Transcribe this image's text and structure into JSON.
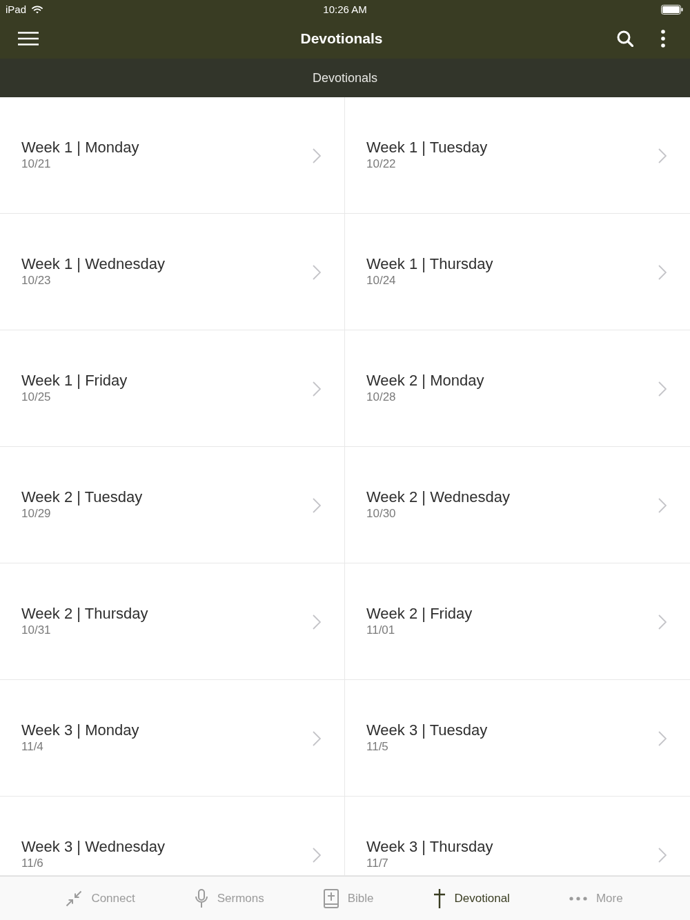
{
  "status_bar": {
    "device": "iPad",
    "time": "10:26 AM"
  },
  "nav_bar": {
    "title": "Devotionals"
  },
  "section_header": {
    "title": "Devotionals"
  },
  "devotionals": [
    {
      "title": "Week 1 | Monday",
      "date": "10/21"
    },
    {
      "title": "Week 1 | Tuesday",
      "date": "10/22"
    },
    {
      "title": "Week 1 | Wednesday",
      "date": "10/23"
    },
    {
      "title": "Week 1 | Thursday",
      "date": "10/24"
    },
    {
      "title": "Week 1 | Friday",
      "date": "10/25"
    },
    {
      "title": "Week 2 | Monday",
      "date": "10/28"
    },
    {
      "title": "Week 2 | Tuesday",
      "date": "10/29"
    },
    {
      "title": "Week 2 | Wednesday",
      "date": "10/30"
    },
    {
      "title": "Week 2 | Thursday",
      "date": "10/31"
    },
    {
      "title": "Week 2 | Friday",
      "date": "11/01"
    },
    {
      "title": "Week 3 | Monday",
      "date": "11/4"
    },
    {
      "title": "Week 3 | Tuesday",
      "date": "11/5"
    },
    {
      "title": "Week 3 | Wednesday",
      "date": "11/6"
    },
    {
      "title": "Week 3 | Thursday",
      "date": "11/7"
    }
  ],
  "tab_bar": [
    {
      "kind": "connect",
      "label": "Connect",
      "selected": false
    },
    {
      "kind": "sermons",
      "label": "Sermons",
      "selected": false
    },
    {
      "kind": "bible",
      "label": "Bible",
      "selected": false
    },
    {
      "kind": "devotional",
      "label": "Devotional",
      "selected": true
    },
    {
      "kind": "more",
      "label": "More",
      "selected": false
    }
  ]
}
